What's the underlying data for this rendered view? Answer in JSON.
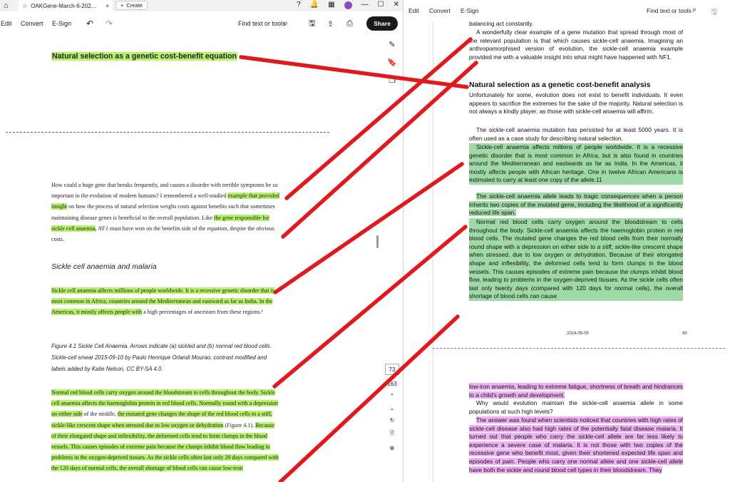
{
  "left_window": {
    "tab_title": "OAKGene-March-6-202...",
    "create_label": "Create",
    "toolbar": {
      "edit": "Edit",
      "convert": "Convert",
      "esign": "E-Sign",
      "find": "Find text or tools",
      "share": "Share"
    },
    "heading": "Natural selection as a genetic cost-benefit equation",
    "para1": "How could a huge gene that breaks frequently, and causes a disorder with terrible symptoms be so important in the evolution of modern humans? I remembered a well-studied example that provided insight on how the process of natural selection weighs costs against benefits such that sometimes maintaining disease genes is beneficial to the overall population. Like the gene responsible for sickle cell anaemia, NF1 must have won on the benefits side of the equation, despite the obvious costs.",
    "section_heading": "Sickle cell anaemia and malaria",
    "para2": "Sickle cell anaemia affects millions of people worldwide. It is a recessive genetic disorder that is most common in Africa, countries around the Mediterranean and eastward as far as India. In the Americas, it mostly affects people with a high percentages of ancestors from these regions.¹",
    "caption": "Figure 4.1 Sickle Cell Anaemia. Arrows indicate (a) sickled and (b) normal red blood cells. Sickle-cell smear 2015-09-10 by Paulo Henrique Orlandi Mourao, contrast modified and labels added by Katie Nelson, CC BY-SA 4.0.",
    "para3": "Normal red blood cells carry oxygen around the bloodstream to cells throughout the body. Sickle cell anaemia affects the haemoglobin protein in red blood cells. Normally round with a depression on either side of the middle, the mutated gene changes the shape of the red blood cells to a stiff, sickle-like crescent shape when stressed due to low oxygen or dehydration (Figure 4.1). Because of their elongated shape and inflexibility, the deformed cells tend to form clumps in the blood vessels. This causes episodes of extreme pain because the clumps inhibit blood flow leading to problems in the oxygen-deprived tissues. As the sickle cells often last only 20 days compared with the 120 days of normal cells, the overall shortage of blood cells can cause low-iron",
    "page_current": "73",
    "page_total": "163"
  },
  "right_window": {
    "toolbar": {
      "edit": "Edit",
      "convert": "Convert",
      "esign": "E-Sign",
      "find": "Find text or tools"
    },
    "top_line": "balancing act constantly.",
    "p0": "A wonderfully clear example of a gene mutation that spread through most of the relevant population is that which causes sickle-cell anaemia. Imagining an anthropomorphised version of evolution, the sickle-cell anaemia example provided me with a valuable insight into what might have happened with NF1.",
    "heading": "Natural selection as a genetic cost-benefit analysis",
    "p1": "Unfortunately for some, evolution does not exist to benefit individuals. It even appears to sacrifice the extremes for the sake of the majority. Natural selection is not always a kindly player, as those with sickle-cell anaemia will affirm.",
    "p2": "The sickle-cell anaemia mutation has persisted for at least 5000 years. It is often used as a case study for describing natural selection.",
    "p3": "Sickle-cell anaemia affects millions of people worldwide. It is a recessive genetic disorder that is most common in Africa, but is also found in countries around the Mediterranean and eastwards as far as India. In the Americas, it mostly affects people with African heritage. One in twelve African Americans is estimated to carry at least one copy of the allele.11",
    "p4": "The sickle-cell anaemia allele leads to tragic consequences when a person inherits two copies of the mutated gene, including the likelihood of a significantly reduced life span.",
    "p5": "Normal red blood cells carry oxygen around the bloodstream to cells throughout the body. Sickle-cell anaemia affects the haemoglobin protein in red blood cells. The mutated gene changes the red blood cells from their normally round shape with a depression on either side to a stiff, sickle-like crescent shape when stressed, due to low oxygen or dehydration. Because of their elongated shape and inflexibility, the deformed cells tend to form clumps in the blood vessels. This causes episodes of extreme pain because the clumps inhibit blood flow, leading to problems in the oxygen-deprived tissues. As the sickle cells often last only twenty days (compared with 120 days for normal cells), the overall shortage of blood cells can cause",
    "footer_date": "2024-09-09",
    "footer_page": "40",
    "p6": "low-iron anaemia, leading to extreme fatigue, shortness of breath and hindrances to a child's growth and development.",
    "p7": "Why would evolution maintain the sickle-cell anaemia allele in some populations at such high levels?",
    "p8": "The answer was found when scientists noticed that countries with high rates of sickle-cell disease also had high rates of the potentially fatal disease malaria. It turned out that people who carry the sickle-cell allele are far less likely to experience a severe case of malaria. It is not those with two copies of the recessive gene who benefit most, given their shortened expected life span and episodes of pain. People who carry one normal allele and one sickle-cell allele have both the sickle and round blood cell types in their bloodstream. They"
  },
  "colors": {
    "highlight_green": "#b6f36b",
    "highlight_pink": "#efb3f5",
    "highlight_teal": "#9fd9a6",
    "annotation_red": "#e0191f"
  },
  "icons": [
    "home-icon",
    "star-icon",
    "plus-icon",
    "help-icon",
    "bell-icon",
    "apps-icon",
    "minimize-icon",
    "maximize-icon",
    "close-icon",
    "undo-icon",
    "redo-icon",
    "search-icon",
    "save-icon",
    "upload-icon",
    "print-icon",
    "comment-icon",
    "bookmark-icon",
    "pages-icon",
    "chevron-up-icon",
    "chevron-down-icon",
    "rotate-icon",
    "page-icon",
    "zoom-in-icon"
  ]
}
